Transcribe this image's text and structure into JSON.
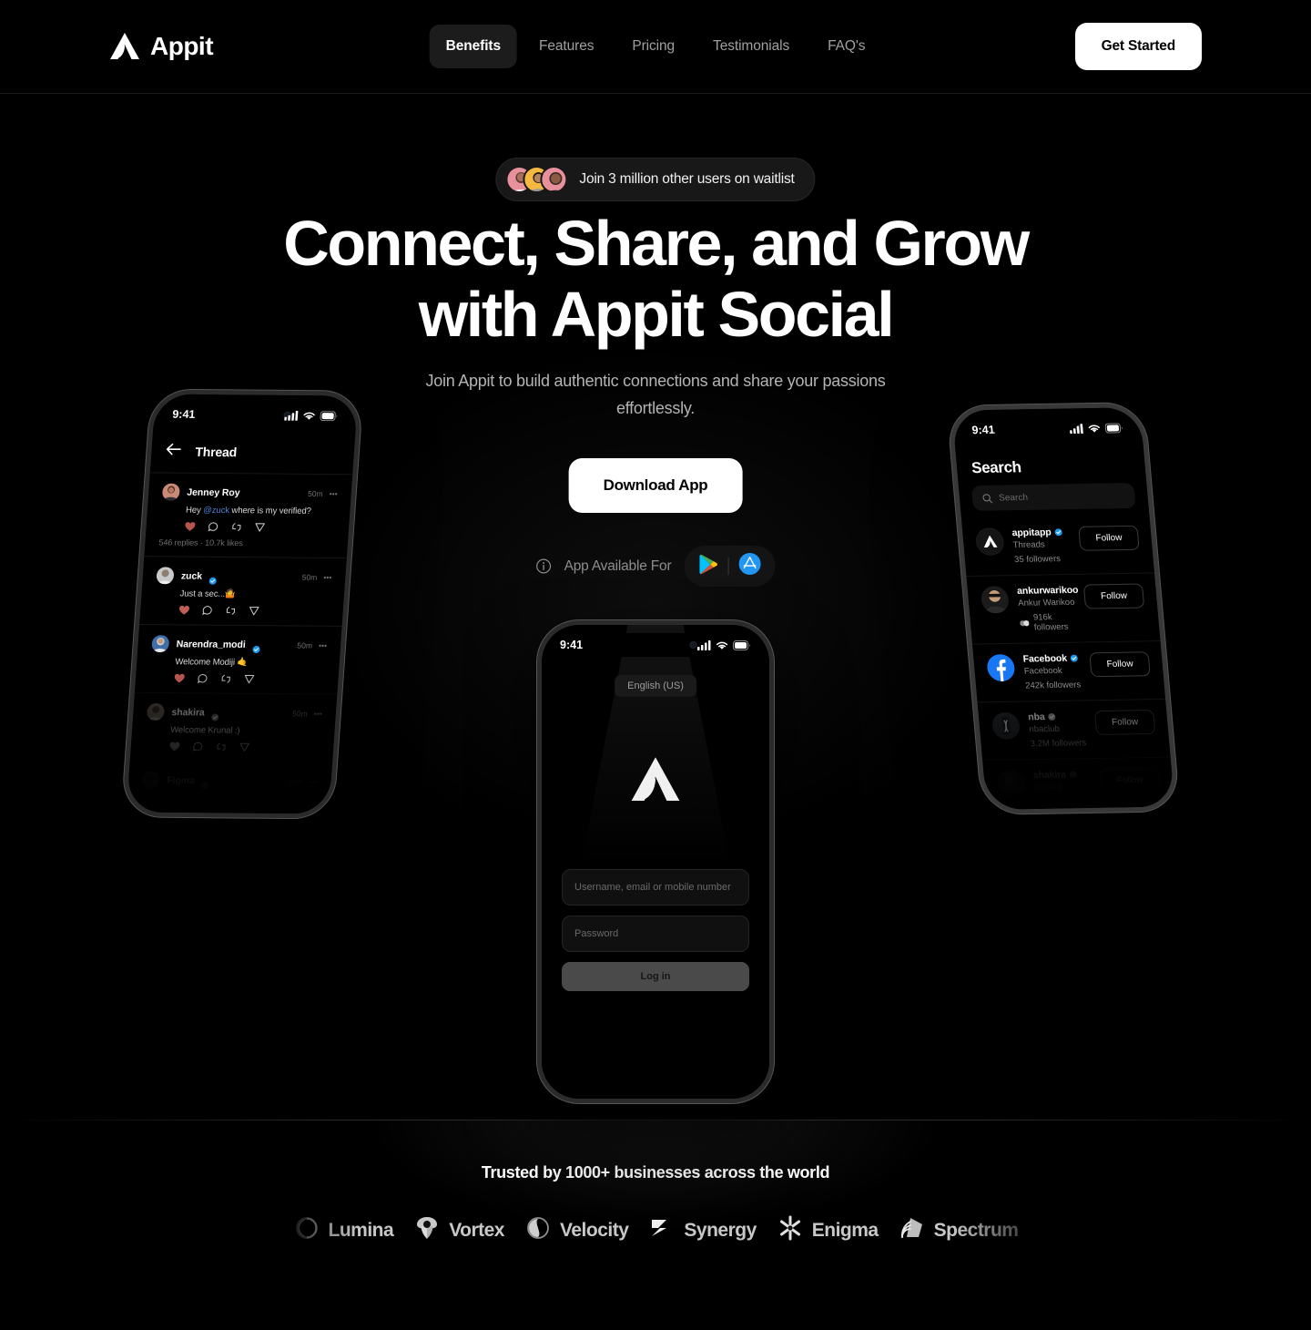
{
  "nav": {
    "brand": "Appit",
    "brand_icon": "appit-logo-icon",
    "links": [
      {
        "label": "Benefits",
        "active": true
      },
      {
        "label": "Features",
        "active": false
      },
      {
        "label": "Pricing",
        "active": false
      },
      {
        "label": "Testimonials",
        "active": false
      },
      {
        "label": "FAQ's",
        "active": false
      }
    ],
    "cta": "Get Started"
  },
  "hero": {
    "pill": "Join 3 million other users on waitlist",
    "headline_line1": "Connect, Share, and Grow",
    "headline_line2": "with Appit Social",
    "subhead_line1": "Join Appit to build authentic connections and share",
    "subhead_line2": "your passions effortlessly.",
    "download_button": "Download App",
    "available_text": "App Available For",
    "stores": [
      "google-play-icon",
      "app-store-icon"
    ]
  },
  "phone_left": {
    "status_time": "9:41",
    "screen_title": "Thread",
    "posts": [
      {
        "name": "Jenney Roy",
        "verified": false,
        "time": "50m",
        "text_pre": "Hey ",
        "mention": "@zuck",
        "text_post": " where is my verified?",
        "stats": "546 replies  ·  10.7k likes"
      },
      {
        "name": "zuck",
        "verified": true,
        "time": "50m",
        "text_pre": "Just a sec...🤷",
        "mention": "",
        "text_post": "",
        "stats": ""
      },
      {
        "name": "Narendra_modi",
        "verified": true,
        "time": "50m",
        "text_pre": "Welcome Modiji 🤙",
        "mention": "",
        "text_post": "",
        "stats": ""
      },
      {
        "name": "shakira",
        "verified": true,
        "time": "50m",
        "text_pre": "Welcome Krunal :)",
        "mention": "",
        "text_post": "",
        "stats": ""
      },
      {
        "name": "Figma",
        "verified": true,
        "time": "50m",
        "text_pre": "",
        "mention": "",
        "text_post": "",
        "stats": ""
      }
    ]
  },
  "phone_center": {
    "status_time": "9:41",
    "language": "English (US)",
    "logo_icon": "appit-logo-icon",
    "username_placeholder": "Username, email or mobile number",
    "password_placeholder": "Password",
    "login_button": "Log in"
  },
  "phone_right": {
    "status_time": "9:41",
    "screen_title": "Search",
    "search_placeholder": "Search",
    "follow_label": "Follow",
    "users": [
      {
        "handle": "appitapp",
        "full": "Threads",
        "followers": "35 followers",
        "verified": true,
        "avatar": "appit-logo-avatar"
      },
      {
        "handle": "ankurwarikoo",
        "full": "Ankur Warikoo",
        "followers": "916k followers",
        "verified": true,
        "avatar": "photo-avatar"
      },
      {
        "handle": "Facebook",
        "full": "Facebook",
        "followers": "242k followers",
        "verified": true,
        "avatar": "facebook-avatar"
      },
      {
        "handle": "nba",
        "full": "nbaclub",
        "followers": "3.2M followers",
        "verified": true,
        "avatar": "nba-avatar"
      },
      {
        "handle": "shakira",
        "full": "shakira",
        "followers": "",
        "verified": true,
        "avatar": "photo-avatar"
      }
    ]
  },
  "trusted": {
    "title": "Trusted by 1000+ businesses across the world",
    "logos": [
      {
        "name": "Lumina",
        "icon": "lumina-icon"
      },
      {
        "name": "Vortex",
        "icon": "vortex-icon"
      },
      {
        "name": "Velocity",
        "icon": "velocity-icon"
      },
      {
        "name": "Synergy",
        "icon": "synergy-icon"
      },
      {
        "name": "Enigma",
        "icon": "enigma-icon"
      },
      {
        "name": "Spectrum",
        "icon": "spectrum-icon"
      }
    ]
  },
  "colors": {
    "background": "#000000",
    "accent_white": "#ffffff",
    "nav_active_bg": "#1c1c1c",
    "muted_text": "#a0a0a0",
    "verified_blue": "#1d9bf0",
    "facebook_blue": "#1877f2"
  }
}
